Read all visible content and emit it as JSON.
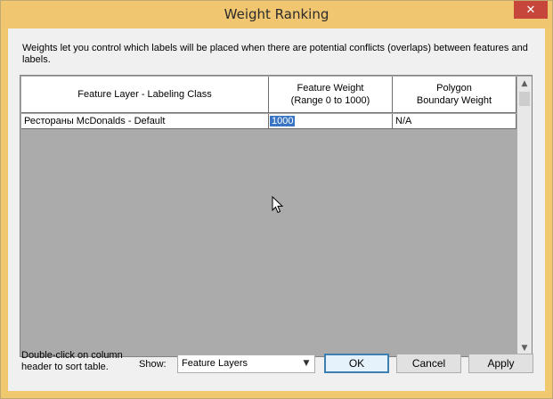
{
  "window": {
    "title": "Weight Ranking",
    "close_glyph": "✕"
  },
  "description": "Weights let you control which labels will be placed when there are potential conflicts (overlaps) between features and labels.",
  "table": {
    "columns": [
      {
        "label": "Feature Layer - Labeling Class"
      },
      {
        "label_line1": "Feature Weight",
        "label_line2": "(Range 0 to 1000)"
      },
      {
        "label_line1": "Polygon",
        "label_line2": "Boundary Weight"
      }
    ],
    "rows": [
      {
        "layer": "Рестораны McDonalds - Default",
        "feature_weight": "1000",
        "boundary_weight": "N/A"
      }
    ]
  },
  "hint": "Double-click on column header to sort table.",
  "show": {
    "label": "Show:",
    "selected": "Feature Layers"
  },
  "buttons": {
    "ok": "OK",
    "cancel": "Cancel",
    "apply": "Apply"
  },
  "icons": {
    "close": "close-icon",
    "cursor": "mouse-pointer-icon",
    "scroll_up": "chevron-up-icon",
    "scroll_down": "chevron-down-icon",
    "dropdown": "chevron-down-icon"
  }
}
